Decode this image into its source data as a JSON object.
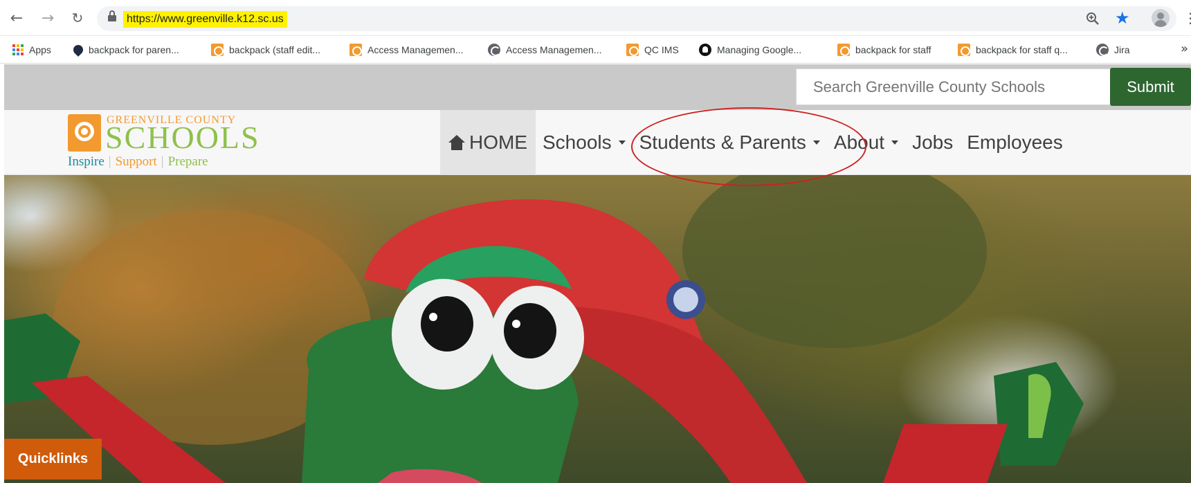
{
  "browser": {
    "url": "https://www.greenville.k12.sc.us",
    "icons": {
      "back": "arrow-left-icon",
      "forward": "arrow-right-icon",
      "reload": "reload-icon",
      "zoom": "zoom-icon",
      "bookmark": "star-icon",
      "profile": "profile-icon",
      "menu": "kebab-menu-icon"
    },
    "bookmarks": [
      {
        "label": "Apps",
        "icon": "apps-icon"
      },
      {
        "label": "backpack for paren...",
        "icon": "drop-icon"
      },
      {
        "label": "backpack (staff edit...",
        "icon": "gcs-logo-icon"
      },
      {
        "label": "Access Managemen...",
        "icon": "gcs-logo-icon"
      },
      {
        "label": "Access Managemen...",
        "icon": "globe-icon"
      },
      {
        "label": "QC IMS",
        "icon": "gcs-logo-icon"
      },
      {
        "label": "Managing Google...",
        "icon": "github-icon"
      },
      {
        "label": "backpack for staff",
        "icon": "gcs-logo-icon"
      },
      {
        "label": "backpack for staff q...",
        "icon": "gcs-logo-icon"
      },
      {
        "label": "Jira",
        "icon": "globe-icon"
      }
    ],
    "bookmarks_overflow": "»"
  },
  "site": {
    "search": {
      "placeholder": "Search Greenville County Schools",
      "submit_label": "Submit"
    },
    "logo": {
      "top": "GREENVILLE COUNTY",
      "main": "SCHOOLS",
      "tag1": "Inspire",
      "tag2": "Support",
      "tag3": "Prepare",
      "sep": "|"
    },
    "nav": [
      {
        "label": "HOME",
        "icon": "home-icon",
        "active": true
      },
      {
        "label": "Schools",
        "dropdown": true
      },
      {
        "label": "Students & Parents",
        "dropdown": true
      },
      {
        "label": "About",
        "dropdown": true
      },
      {
        "label": "Jobs"
      },
      {
        "label": "Employees"
      }
    ],
    "quicklinks": "Quicklinks",
    "colors": {
      "accent_orange": "#cf5b0b",
      "submit_green": "#2e6630",
      "logo_orange": "#f29a2e",
      "logo_green": "#8fc04c",
      "annotation_red": "#d02020",
      "url_highlight": "#fff200"
    }
  }
}
